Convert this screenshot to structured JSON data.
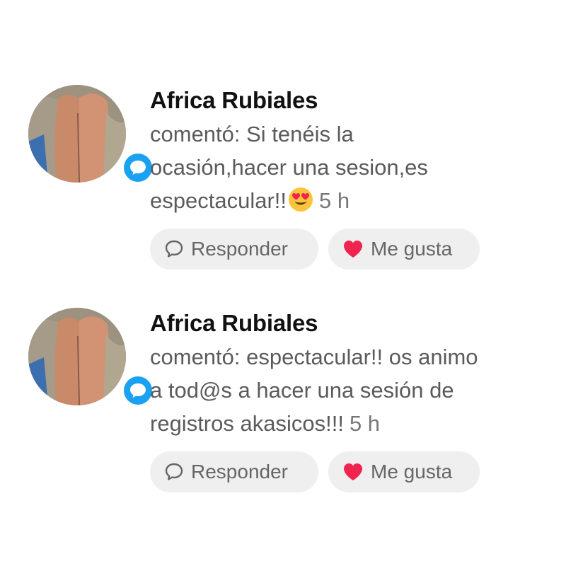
{
  "notifications": [
    {
      "user_name": "Africa Rubiales",
      "comment_lines": [
        "comentó: Si tenéis la",
        "ocasión,hacer una sesion,es",
        "espectacular!!"
      ],
      "emoji": "heart-eyes-emoji",
      "time": "5 h",
      "reply_label": "Responder",
      "like_label": "Me gusta"
    },
    {
      "user_name": "Africa Rubiales",
      "comment_lines": [
        "comentó: espectacular!! os animo",
        "a tod@s a hacer una sesión de",
        "registros akasicos!!!"
      ],
      "time": "5 h",
      "reply_label": "Responder",
      "like_label": "Me gusta"
    }
  ],
  "colors": {
    "badge": "#1aa1f2",
    "heart": "#f0244e",
    "pill_bg": "#efefef",
    "name": "#111111",
    "comment": "#5b5b5b"
  },
  "icons": [
    "comment-badge-icon",
    "speech-bubble-icon",
    "heart-icon",
    "heart-eyes-emoji"
  ]
}
